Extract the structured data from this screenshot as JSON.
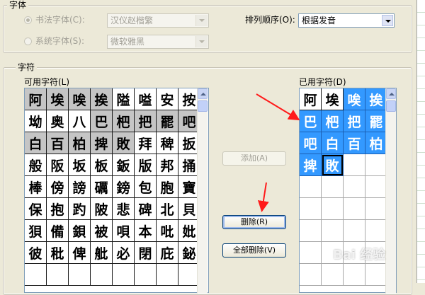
{
  "font_group": {
    "title": "字体",
    "calligraphy_label": "书法字体(C):",
    "calligraphy_value": "汉仪赵楷繁",
    "system_label": "系统字体(S):",
    "system_value": "微软雅黑",
    "order_label": "排列顺序(O):",
    "order_value": "根据发音"
  },
  "chars_group": {
    "title": "字符",
    "available_label": "可用字符(L)",
    "used_label": "已用字符(D)"
  },
  "available_chars": [
    [
      "阿",
      "埃",
      "唉",
      "挨",
      "隘",
      "嗌",
      "安",
      "按"
    ],
    [
      "坳",
      "奥",
      "八",
      "巴",
      "杷",
      "把",
      "罷",
      "吧"
    ],
    [
      "白",
      "百",
      "柏",
      "捭",
      "敗",
      "拜",
      "稗",
      "扳"
    ],
    [
      "般",
      "阪",
      "坂",
      "板",
      "鈑",
      "版",
      "邦",
      "捅"
    ],
    [
      "棒",
      "傍",
      "謗",
      "礪",
      "鎊",
      "包",
      "胞",
      "寶"
    ],
    [
      "保",
      "抱",
      "趵",
      "陂",
      "悲",
      "碑",
      "北",
      "貝"
    ],
    [
      "狽",
      "備",
      "鋇",
      "被",
      "唄",
      "本",
      "吡",
      "妣"
    ],
    [
      "彼",
      "秕",
      "俾",
      "舭",
      "必",
      "閉",
      "庇",
      "鉍"
    ],
    [
      "",
      "",
      "",
      "",
      "",
      "",
      "",
      ""
    ]
  ],
  "available_used_flags": [
    [
      1,
      1,
      1,
      1,
      0,
      0,
      0,
      0
    ],
    [
      0,
      0,
      0,
      1,
      1,
      1,
      1,
      1
    ],
    [
      1,
      1,
      1,
      1,
      1,
      0,
      0,
      0
    ]
  ],
  "used_chars": [
    [
      "阿",
      "埃",
      "唉",
      "挨"
    ],
    [
      "巴",
      "杷",
      "把",
      "罷"
    ],
    [
      "吧",
      "白",
      "百",
      "柏"
    ],
    [
      "捭",
      "敗",
      "",
      ""
    ],
    [
      "",
      "",
      "",
      ""
    ],
    [
      "",
      "",
      "",
      ""
    ],
    [
      "",
      "",
      "",
      ""
    ],
    [
      "",
      "",
      "",
      ""
    ],
    [
      "",
      "",
      "",
      ""
    ]
  ],
  "buttons": {
    "add": "添加(A)",
    "delete": "删除(R)",
    "delete_all": "全部删除(V)"
  },
  "watermark": "Bai 经验",
  "colors": {
    "selection": "#3399ff",
    "arrow": "#ff1a1a"
  }
}
